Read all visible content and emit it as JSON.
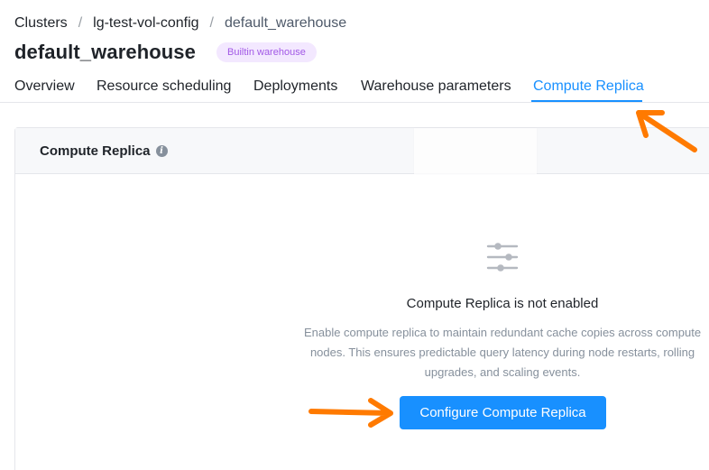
{
  "breadcrumb": {
    "items": [
      "Clusters",
      "lg-test-vol-config",
      "default_warehouse"
    ],
    "separator": "/"
  },
  "header": {
    "title": "default_warehouse",
    "badge": "Builtin warehouse"
  },
  "tabs": [
    {
      "label": "Overview",
      "active": false
    },
    {
      "label": "Resource scheduling",
      "active": false
    },
    {
      "label": "Deployments",
      "active": false
    },
    {
      "label": "Warehouse parameters",
      "active": false
    },
    {
      "label": "Compute Replica",
      "active": true
    }
  ],
  "panel": {
    "title": "Compute Replica",
    "info_icon": "i"
  },
  "empty_state": {
    "icon": "sliders-icon",
    "title": "Compute Replica is not enabled",
    "description_lines": [
      "Enable compute replica to maintain redundant cache copies across compute",
      "nodes. This ensures predictable query latency during node restarts, rolling",
      "upgrades, and scaling events."
    ],
    "button_label": "Configure Compute Replica"
  },
  "colors": {
    "accent": "#1890ff",
    "annotation_arrow": "#ff7a00",
    "badge_bg": "#f3e8ff",
    "badge_text": "#a259e6"
  }
}
